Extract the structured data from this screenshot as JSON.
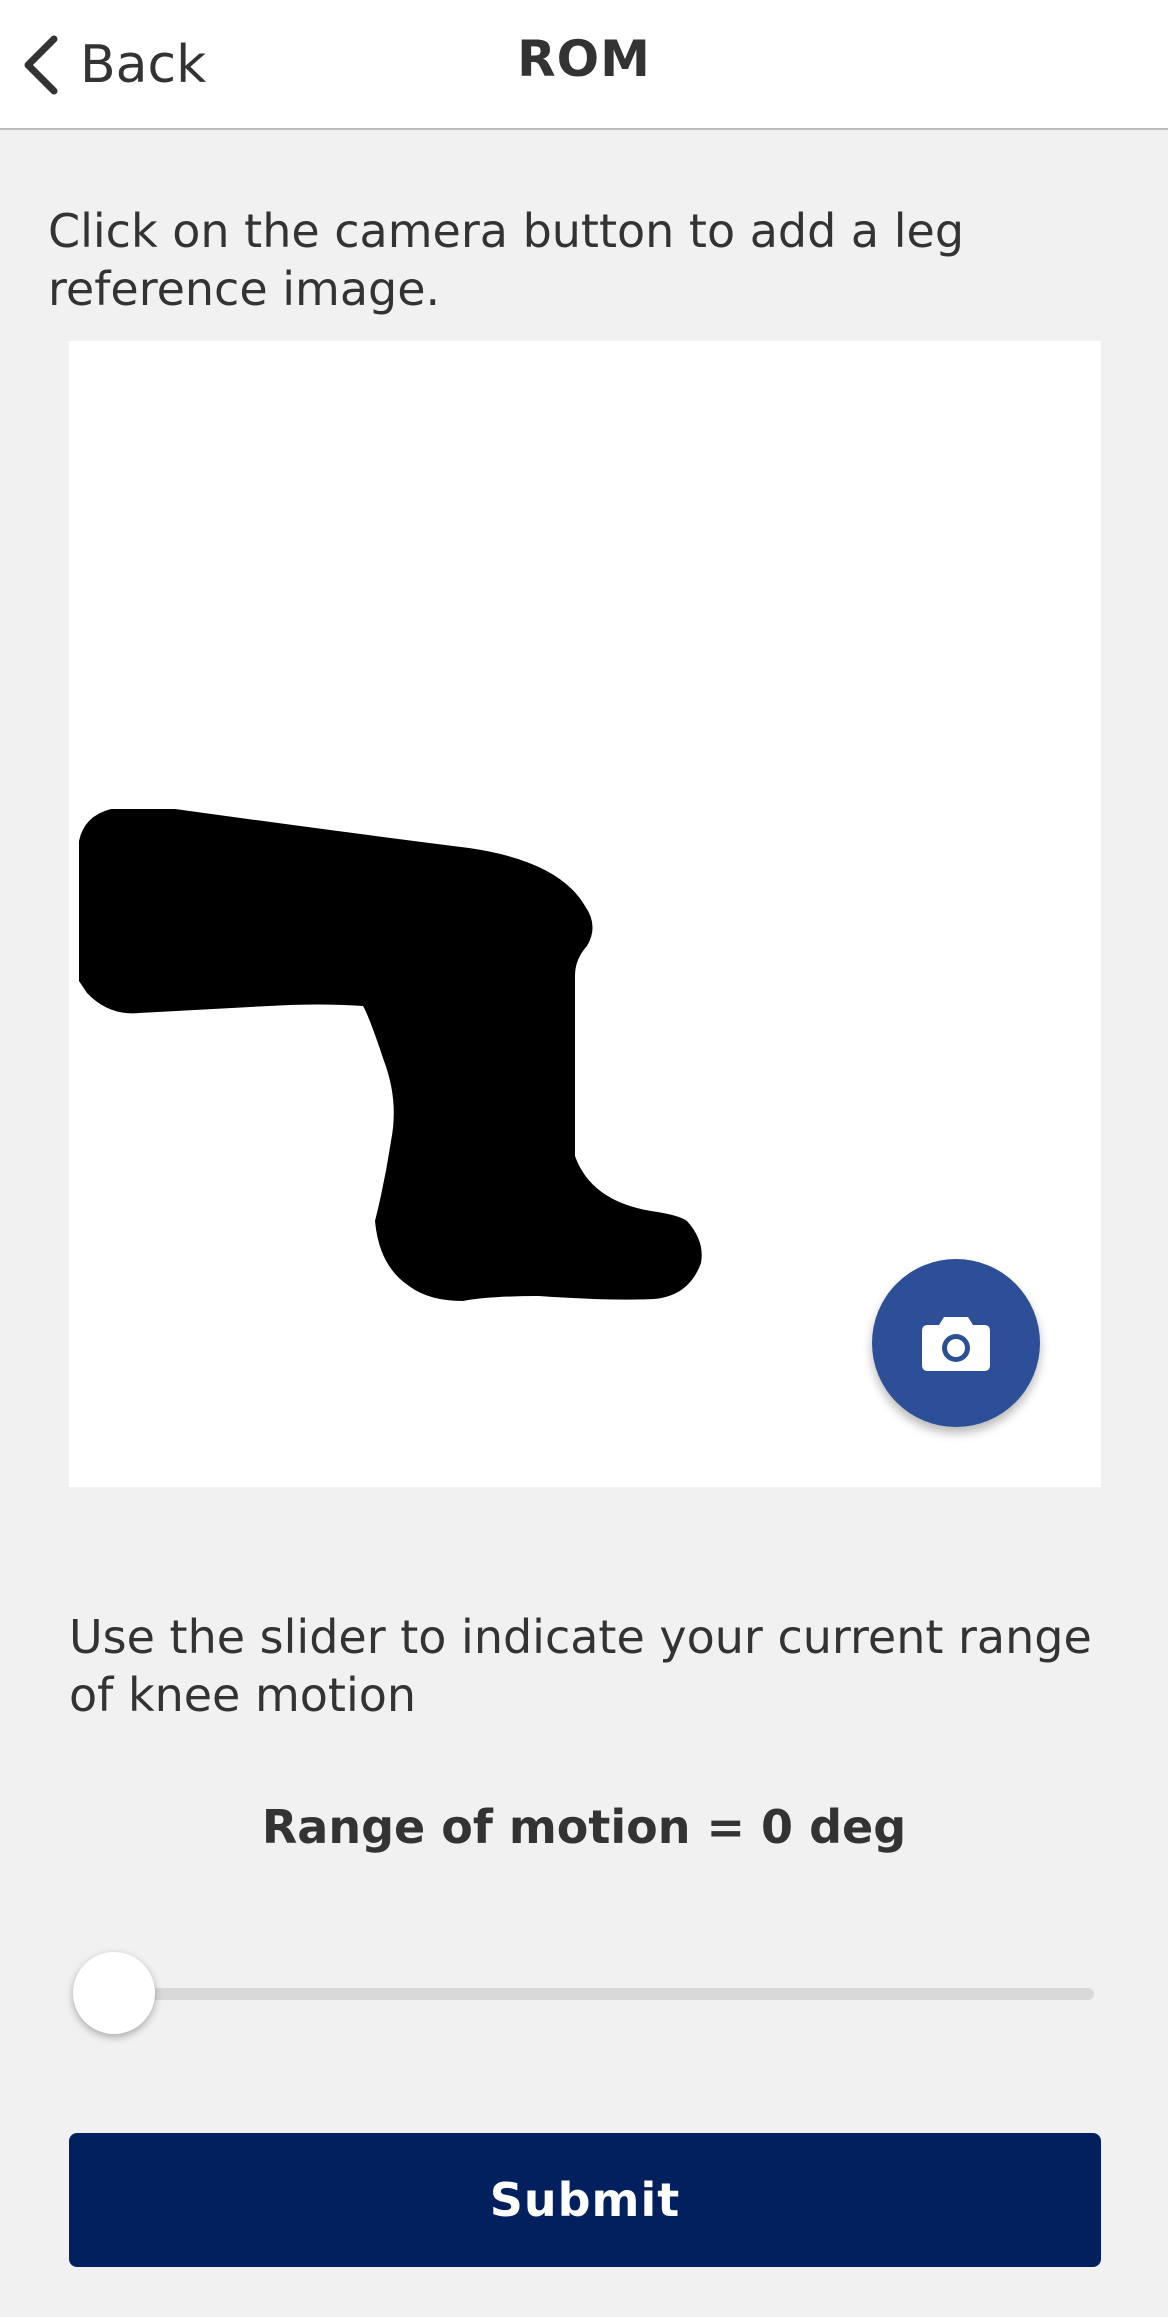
{
  "header": {
    "back_label": "Back",
    "title": "ROM"
  },
  "instructions": {
    "image_prompt": "Click on the camera button to add a leg reference image.",
    "slider_prompt": "Use the slider to indicate your current range of knee motion"
  },
  "camera": {
    "icon": "camera-icon",
    "color": "#2d4f98"
  },
  "range_of_motion": {
    "readout": "Range of motion = 0 deg",
    "value_deg": 0,
    "slider_fraction": 0
  },
  "submit": {
    "label": "Submit",
    "color": "#02205d"
  }
}
